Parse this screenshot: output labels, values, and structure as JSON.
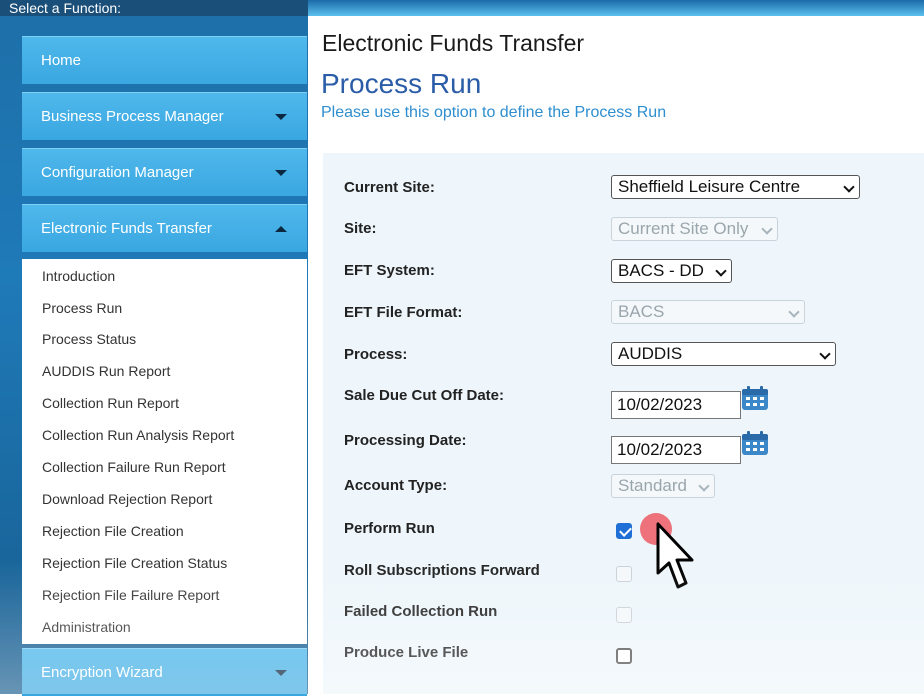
{
  "sidebar": {
    "header": "Select a Function:",
    "menus": [
      {
        "label": "Home",
        "arrow": ""
      },
      {
        "label": "Business Process Manager",
        "arrow": "down"
      },
      {
        "label": "Configuration Manager",
        "arrow": "down"
      },
      {
        "label": "Electronic Funds Transfer",
        "arrow": "up"
      },
      {
        "label": "Encryption Wizard",
        "arrow": "down"
      }
    ],
    "submenu": [
      "Introduction",
      "Process Run",
      "Process Status",
      "AUDDIS Run Report",
      "Collection Run Report",
      "Collection Run Analysis Report",
      "Collection Failure Run Report",
      "Download Rejection Report",
      "Rejection File Creation",
      "Rejection File Creation Status",
      "Rejection File Failure Report",
      "Administration"
    ]
  },
  "header": {
    "app_title": "Electronic Funds Transfer",
    "page_title": "Process Run",
    "subtitle": "Please use this option to define the Process Run"
  },
  "form": {
    "current_site": {
      "label": "Current Site:",
      "value": "Sheffield Leisure Centre"
    },
    "site": {
      "label": "Site:",
      "value": "Current Site Only"
    },
    "eft_system": {
      "label": "EFT System:",
      "value": "BACS - DD"
    },
    "eft_file_format": {
      "label": "EFT File Format:",
      "value": "BACS"
    },
    "process": {
      "label": "Process:",
      "value": "AUDDIS"
    },
    "sale_due_cut_off_date": {
      "label": "Sale Due Cut Off Date:",
      "value": "10/02/2023"
    },
    "processing_date": {
      "label": "Processing Date:",
      "value": "10/02/2023"
    },
    "account_type": {
      "label": "Account Type:",
      "value": "Standard"
    },
    "perform_run": {
      "label": "Perform Run",
      "checked": true
    },
    "roll_subscriptions_forward": {
      "label": "Roll Subscriptions Forward",
      "checked": false
    },
    "failed_collection_run": {
      "label": "Failed Collection Run",
      "checked": false
    },
    "produce_live_file": {
      "label": "Produce Live File",
      "checked": false
    }
  },
  "colors": {
    "accent": "#3aa7e0",
    "title": "#2a5ca8",
    "checkbox_checked": "#1f6fd6",
    "click_indicator": "#ec5a64"
  },
  "icons": {
    "calendar": "calendar-icon",
    "cursor": "pointer-hand-icon",
    "dropdown": "chevron-down-icon"
  }
}
